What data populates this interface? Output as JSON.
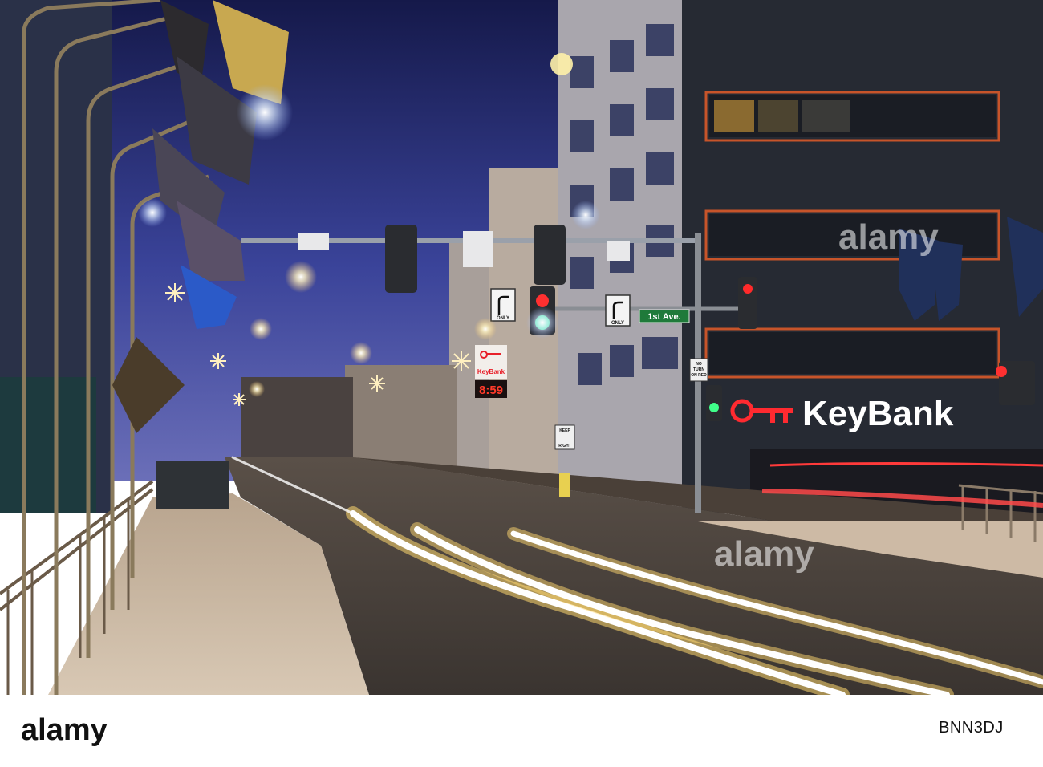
{
  "scene": {
    "bank_sign": "KeyBank",
    "small_bank_sign": "KeyBank",
    "street_sign": "1st Ave.",
    "clock_display": "8:59",
    "turn_sign_word": "ONLY",
    "keep_right_line1": "KEEP",
    "keep_right_line2": "RIGHT",
    "no_turn_line1": "NO",
    "no_turn_line2": "TURN",
    "no_turn_line3": "ON RED",
    "watermark": "alamy"
  },
  "footer": {
    "logo_text": "alamy",
    "image_id": "BNN3DJ"
  },
  "colors": {
    "sky_top": "#1a1f4d",
    "sky_bottom": "#5a66b8",
    "brand_red": "#e8202a",
    "street_sign_green": "#1f7a3a"
  }
}
